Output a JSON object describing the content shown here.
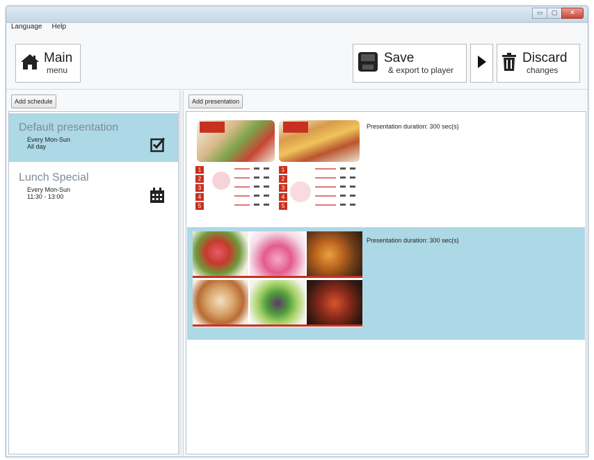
{
  "menubar": {
    "language": "Language",
    "help": "Help"
  },
  "window_controls": {
    "minimize": "▭",
    "maximize": "▢",
    "close": "✕"
  },
  "toolbar": {
    "main_label": "Main",
    "main_sub": "menu",
    "save_label": "Save",
    "save_sub": "& export to player",
    "discard_label": "Discard",
    "discard_sub": "changes"
  },
  "left": {
    "add_schedule": "Add schedule",
    "schedules": [
      {
        "title": "Default presentation",
        "days": "Every Mon-Sun",
        "time": "All day",
        "icon": "checkbox-checked-icon",
        "selected": true
      },
      {
        "title": "Lunch Special",
        "days": "Every Mon-Sun",
        "time": "11:30 - 13:00",
        "icon": "calendar-icon",
        "selected": false
      }
    ]
  },
  "right": {
    "add_presentation": "Add presentation",
    "presentations": [
      {
        "duration": "Presentation duration: 300 sec(s)",
        "selected": false
      },
      {
        "duration": "Presentation duration: 300 sec(s)",
        "selected": true
      }
    ]
  },
  "colors": {
    "selection": "#add8e6",
    "accent_red": "#c8311f"
  }
}
